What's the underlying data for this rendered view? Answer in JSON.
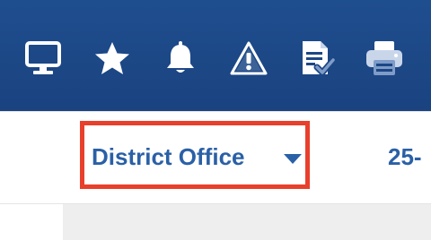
{
  "toolbar": {
    "icons": [
      {
        "name": "monitor-icon"
      },
      {
        "name": "star-icon"
      },
      {
        "name": "bell-icon"
      },
      {
        "name": "warning-icon"
      },
      {
        "name": "document-check-icon"
      },
      {
        "name": "printer-icon"
      }
    ],
    "background": "#1c4785"
  },
  "office_selector": {
    "label": "District Office",
    "highlight_color": "#e8402c",
    "text_color": "#2a60a6"
  },
  "date_range": {
    "partial_text": "25-"
  }
}
